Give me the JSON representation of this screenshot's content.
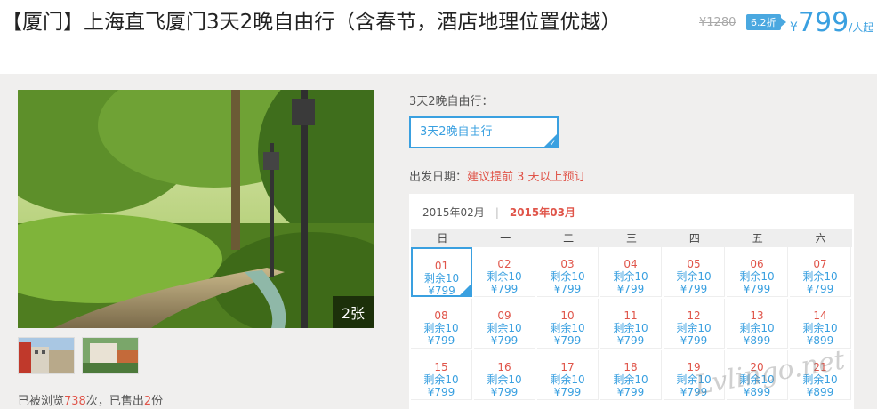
{
  "product": {
    "title": "【厦门】上海直飞厦门3天2晚自由行（含春节，酒店地理位置优越）",
    "orig_price": "¥1280",
    "discount": "6.2折",
    "price_yen": "¥",
    "price": "799",
    "price_unit": "/人起"
  },
  "gallery": {
    "count_label": "2张"
  },
  "stats": {
    "views_prefix": "已被浏览",
    "views": "738",
    "views_suffix": "次，已售出",
    "sold": "2",
    "sold_suffix": "份"
  },
  "route": {
    "label": "3天2晚自由行：",
    "option": "3天2晚自由行"
  },
  "departure": {
    "label": "出发日期：",
    "hint": "建议提前 3 天以上预订"
  },
  "calendar": {
    "months": [
      "2015年02月",
      "2015年03月"
    ],
    "month_sep": "|",
    "weekdays": [
      "日",
      "一",
      "二",
      "三",
      "四",
      "五",
      "六"
    ],
    "days": [
      {
        "d": "01",
        "r": "剩余10",
        "p": "¥799",
        "selected": true
      },
      {
        "d": "02",
        "r": "剩余10",
        "p": "¥799"
      },
      {
        "d": "03",
        "r": "剩余10",
        "p": "¥799"
      },
      {
        "d": "04",
        "r": "剩余10",
        "p": "¥799"
      },
      {
        "d": "05",
        "r": "剩余10",
        "p": "¥799"
      },
      {
        "d": "06",
        "r": "剩余10",
        "p": "¥799"
      },
      {
        "d": "07",
        "r": "剩余10",
        "p": "¥799"
      },
      {
        "d": "08",
        "r": "剩余10",
        "p": "¥799"
      },
      {
        "d": "09",
        "r": "剩余10",
        "p": "¥799"
      },
      {
        "d": "10",
        "r": "剩余10",
        "p": "¥799"
      },
      {
        "d": "11",
        "r": "剩余10",
        "p": "¥799"
      },
      {
        "d": "12",
        "r": "剩余10",
        "p": "¥799"
      },
      {
        "d": "13",
        "r": "剩余10",
        "p": "¥899"
      },
      {
        "d": "14",
        "r": "剩余10",
        "p": "¥899"
      },
      {
        "d": "15",
        "r": "剩余10",
        "p": "¥799"
      },
      {
        "d": "16",
        "r": "剩余10",
        "p": "¥799"
      },
      {
        "d": "17",
        "r": "剩余10",
        "p": "¥799"
      },
      {
        "d": "18",
        "r": "剩余10",
        "p": "¥799"
      },
      {
        "d": "19",
        "r": "剩余10",
        "p": "¥799"
      },
      {
        "d": "20",
        "r": "剩余10",
        "p": "¥899"
      },
      {
        "d": "21",
        "r": "剩余10",
        "p": "¥899"
      }
    ]
  },
  "watermark": "Lvlingo.net"
}
